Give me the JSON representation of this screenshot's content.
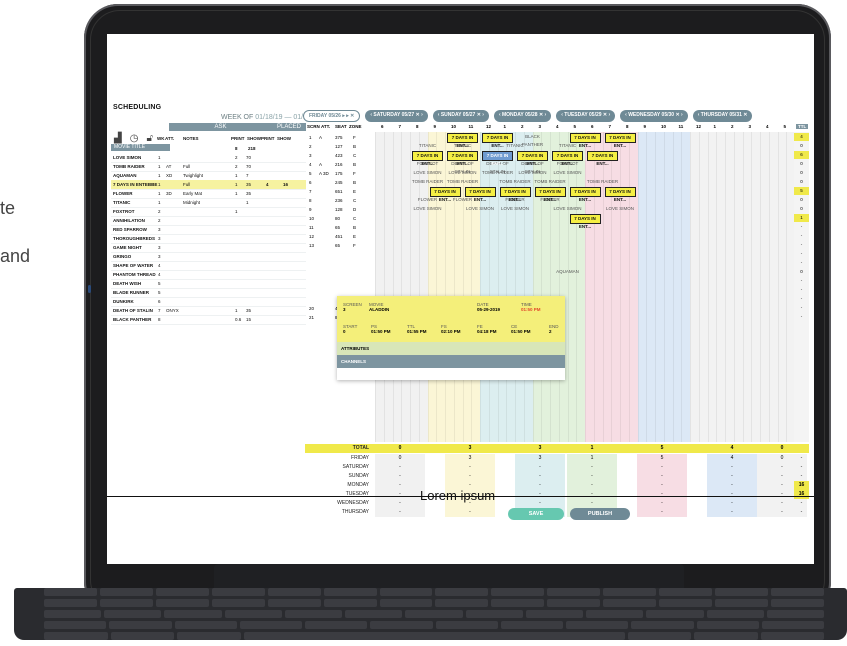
{
  "side_text": [
    "te",
    "and"
  ],
  "app": {
    "title": "SCHEDULING",
    "week_label": "WEEK OF",
    "week_from": "01/18/19",
    "week_sep": "—",
    "week_to": "01/24/19"
  },
  "day_tabs": [
    "FRIDAY 05/26 ▸ ▸ ✕",
    "‹ SATURDAY 05/27 ✕ ›",
    "‹ SUNDAY 05/27 ✕ ›",
    "‹ MONDAY 05/28 ✕ ›",
    "‹ TUESDAY 05/29 ✕ ›",
    "‹ WEDNESDAY 05/30 ✕ ›",
    "‹ THURSDAY 05/31 ✕"
  ],
  "left": {
    "ask": "ASK",
    "placed": "PLACED",
    "movie_title_header": "MOVIE TITLE",
    "columns": [
      "WK",
      "ATT.",
      "NOTES",
      "PRINT",
      "SHOW",
      "PRINT",
      "SHOW"
    ],
    "totals_row": {
      "print": "8",
      "show": "218"
    },
    "movies": [
      {
        "title": "LOVE SIMON",
        "wk": "1",
        "att": "",
        "notes": "",
        "print": "2",
        "show": "70",
        "pprint": "",
        "pshow": "",
        "hl": false
      },
      {
        "title": "TOMB RAIDER",
        "wk": "1",
        "att": "AT",
        "notes": "Full",
        "print": "2",
        "show": "70",
        "pprint": "",
        "pshow": "",
        "hl": false
      },
      {
        "title": "AQUAMAN",
        "wk": "1",
        "att": "XD",
        "notes": "Twighlight",
        "print": "1",
        "show": "7",
        "pprint": "",
        "pshow": "",
        "hl": false
      },
      {
        "title": "7 DAYS IN ENTEBBE",
        "wk": "1",
        "att": "",
        "notes": "Full",
        "print": "1",
        "show": "35",
        "pprint": "4",
        "pshow": "16",
        "hl": true
      },
      {
        "title": "FLOWER",
        "wk": "1",
        "att": "3D",
        "notes": "Early Mat",
        "print": "1",
        "show": "35",
        "pprint": "",
        "pshow": "",
        "hl": false
      },
      {
        "title": "TITANIC",
        "wk": "1",
        "att": "",
        "notes": "Midnight",
        "print": "",
        "show": "1",
        "pprint": "",
        "pshow": "",
        "hl": false
      },
      {
        "title": "FOXTROT",
        "wk": "2",
        "att": "",
        "notes": "",
        "print": "1",
        "show": "",
        "pprint": "",
        "pshow": "",
        "hl": false
      },
      {
        "title": "ANNIHILATION",
        "wk": "2",
        "att": "",
        "notes": "",
        "print": "",
        "show": "",
        "pprint": "",
        "pshow": "",
        "hl": false
      },
      {
        "title": "RED SPARROW",
        "wk": "3",
        "att": "",
        "notes": "",
        "print": "",
        "show": "",
        "pprint": "",
        "pshow": "",
        "hl": false
      },
      {
        "title": "THOROUGHBREDS",
        "wk": "3",
        "att": "",
        "notes": "",
        "print": "",
        "show": "",
        "pprint": "",
        "pshow": "",
        "hl": false
      },
      {
        "title": "GAME NIGHT",
        "wk": "3",
        "att": "",
        "notes": "",
        "print": "",
        "show": "",
        "pprint": "",
        "pshow": "",
        "hl": false
      },
      {
        "title": "GRINGO",
        "wk": "3",
        "att": "",
        "notes": "",
        "print": "",
        "show": "",
        "pprint": "",
        "pshow": "",
        "hl": false
      },
      {
        "title": "SHAPE OF WATER",
        "wk": "4",
        "att": "",
        "notes": "",
        "print": "",
        "show": "",
        "pprint": "",
        "pshow": "",
        "hl": false
      },
      {
        "title": "PHANTOM THREAD",
        "wk": "4",
        "att": "",
        "notes": "",
        "print": "",
        "show": "",
        "pprint": "",
        "pshow": "",
        "hl": false
      },
      {
        "title": "DEATH WISH",
        "wk": "5",
        "att": "",
        "notes": "",
        "print": "",
        "show": "",
        "pprint": "",
        "pshow": "",
        "hl": false
      },
      {
        "title": "BLADE RUNNER",
        "wk": "5",
        "att": "",
        "notes": "",
        "print": "",
        "show": "",
        "pprint": "",
        "pshow": "",
        "hl": false
      },
      {
        "title": "DUNKIRK",
        "wk": "6",
        "att": "",
        "notes": "",
        "print": "",
        "show": "",
        "pprint": "",
        "pshow": "",
        "hl": false
      },
      {
        "title": "DEATH OF STALIN",
        "wk": "7",
        "att": "ONYX",
        "notes": "",
        "print": "1",
        "show": "35",
        "pprint": "",
        "pshow": "",
        "hl": false
      },
      {
        "title": "BLACK PANTHER",
        "wk": "8",
        "att": "",
        "notes": "",
        "print": "0.6",
        "show": "15",
        "pprint": "",
        "pshow": "",
        "hl": false
      }
    ]
  },
  "grid": {
    "headers": [
      "SCRN",
      "ATT.",
      "SEAT",
      "ZONE"
    ],
    "hours": [
      "6",
      "7",
      "8",
      "9",
      "10",
      "11",
      "12",
      "1",
      "2",
      "3",
      "4",
      "5",
      "6",
      "7",
      "8",
      "9",
      "10",
      "11",
      "12",
      "1",
      "2",
      "3",
      "4",
      "5"
    ],
    "ttl_label": "TTL",
    "screens": [
      {
        "scrn": "1",
        "att": "A",
        "seat": "375",
        "zone": "F",
        "ttl": "4"
      },
      {
        "scrn": "2",
        "att": "",
        "seat": "127",
        "zone": "B",
        "ttl": "0"
      },
      {
        "scrn": "3",
        "att": "",
        "seat": "423",
        "zone": "C",
        "ttl": "6"
      },
      {
        "scrn": "4",
        "att": "A",
        "seat": "216",
        "zone": "B",
        "ttl": "0"
      },
      {
        "scrn": "5",
        "att": "A 3D",
        "seat": "175",
        "zone": "F",
        "ttl": "0"
      },
      {
        "scrn": "6",
        "att": "",
        "seat": "245",
        "zone": "B",
        "ttl": "0"
      },
      {
        "scrn": "7",
        "att": "",
        "seat": "651",
        "zone": "E",
        "ttl": "5"
      },
      {
        "scrn": "8",
        "att": "",
        "seat": "236",
        "zone": "C",
        "ttl": "0"
      },
      {
        "scrn": "9",
        "att": "",
        "seat": "128",
        "zone": "D",
        "ttl": "0"
      },
      {
        "scrn": "10",
        "att": "",
        "seat": "80",
        "zone": "C",
        "ttl": "1"
      },
      {
        "scrn": "11",
        "att": "",
        "seat": "65",
        "zone": "B",
        "ttl": "-"
      },
      {
        "scrn": "12",
        "att": "",
        "seat": "451",
        "zone": "E",
        "ttl": "-"
      },
      {
        "scrn": "13",
        "att": "",
        "seat": "65",
        "zone": "F",
        "ttl": "-"
      },
      {
        "scrn": "",
        "att": "",
        "seat": "",
        "zone": "",
        "ttl": "-"
      },
      {
        "scrn": "",
        "att": "",
        "seat": "",
        "zone": "",
        "ttl": "-"
      },
      {
        "scrn": "",
        "att": "",
        "seat": "",
        "zone": "",
        "ttl": "0"
      },
      {
        "scrn": "",
        "att": "",
        "seat": "",
        "zone": "",
        "ttl": "-"
      },
      {
        "scrn": "",
        "att": "",
        "seat": "",
        "zone": "",
        "ttl": "-"
      },
      {
        "scrn": "",
        "att": "",
        "seat": "",
        "zone": "",
        "ttl": "-"
      },
      {
        "scrn": "20",
        "att": "",
        "seat": "451",
        "zone": "A",
        "ttl": "-"
      },
      {
        "scrn": "21",
        "att": "",
        "seat": "87",
        "zone": "B",
        "ttl": "-"
      }
    ],
    "blocks": [
      {
        "row": 0,
        "col": 4,
        "w": 2,
        "text": "7 DAYS IN ENT...",
        "kind": "yellow"
      },
      {
        "row": 0,
        "col": 6,
        "w": 2,
        "text": "7 DAYS IN ENT...",
        "kind": "yellow"
      },
      {
        "row": 0,
        "col": 11,
        "w": 2,
        "text": "7 DAYS IN ENT...",
        "kind": "yellow"
      },
      {
        "row": 0,
        "col": 13,
        "w": 2,
        "text": "7 DAYS IN ENT...",
        "kind": "yellow"
      },
      {
        "row": 2,
        "col": 2,
        "w": 2,
        "text": "7 DAYS IN ENT...",
        "kind": "yellow"
      },
      {
        "row": 2,
        "col": 4,
        "w": 2,
        "text": "7 DAYS IN ENT...",
        "kind": "yellow"
      },
      {
        "row": 2,
        "col": 6,
        "w": 2,
        "text": "7 DAYS IN ENT...",
        "kind": "blue"
      },
      {
        "row": 2,
        "col": 8,
        "w": 2,
        "text": "7 DAYS IN ENT...",
        "kind": "yellow"
      },
      {
        "row": 2,
        "col": 10,
        "w": 2,
        "text": "7 DAYS IN ENT...",
        "kind": "yellow"
      },
      {
        "row": 2,
        "col": 12,
        "w": 2,
        "text": "7 DAYS IN ENT...",
        "kind": "yellow"
      },
      {
        "row": 6,
        "col": 3,
        "w": 2,
        "text": "7 DAYS IN ENT...",
        "kind": "yellow"
      },
      {
        "row": 6,
        "col": 5,
        "w": 2,
        "text": "7 DAYS IN ENT...",
        "kind": "yellow"
      },
      {
        "row": 6,
        "col": 7,
        "w": 2,
        "text": "7 DAYS IN ENT...",
        "kind": "yellow"
      },
      {
        "row": 6,
        "col": 9,
        "w": 2,
        "text": "7 DAYS IN ENT...",
        "kind": "yellow"
      },
      {
        "row": 6,
        "col": 11,
        "w": 2,
        "text": "7 DAYS IN ENT...",
        "kind": "yellow"
      },
      {
        "row": 6,
        "col": 13,
        "w": 2,
        "text": "7 DAYS IN ENT...",
        "kind": "yellow"
      },
      {
        "row": 9,
        "col": 11,
        "w": 2,
        "text": "7 DAYS IN ENT...",
        "kind": "yellow"
      }
    ],
    "labels": [
      {
        "row": 0,
        "col": 8,
        "w": 2,
        "text": "BLACK PANTHER"
      },
      {
        "row": 1,
        "col": 2,
        "w": 2,
        "text": "TITANIC"
      },
      {
        "row": 1,
        "col": 4,
        "w": 2,
        "text": "TITANIC"
      },
      {
        "row": 1,
        "col": 7,
        "w": 2,
        "text": "TITANIC"
      },
      {
        "row": 1,
        "col": 10,
        "w": 2,
        "text": "TITANIC"
      },
      {
        "row": 3,
        "col": 2,
        "w": 2,
        "text": "FOXTROT"
      },
      {
        "row": 3,
        "col": 4,
        "w": 2,
        "text": "DEATH OF STALIN"
      },
      {
        "row": 3,
        "col": 6,
        "w": 2,
        "text": "DEATH OF STALIN"
      },
      {
        "row": 3,
        "col": 8,
        "w": 2,
        "text": "DEATH OF STALIN"
      },
      {
        "row": 3,
        "col": 10,
        "w": 2,
        "text": "FOXTROT"
      },
      {
        "row": 4,
        "col": 2,
        "w": 2,
        "text": "LOVE SIMON"
      },
      {
        "row": 4,
        "col": 4,
        "w": 2,
        "text": "LOVE SIMON"
      },
      {
        "row": 4,
        "col": 6,
        "w": 2,
        "text": "TOMB RAIDER"
      },
      {
        "row": 4,
        "col": 8,
        "w": 2,
        "text": "LOVE SIMON"
      },
      {
        "row": 4,
        "col": 10,
        "w": 2,
        "text": "LOVE SIMON"
      },
      {
        "row": 5,
        "col": 2,
        "w": 2,
        "text": "TOMB RAIDER"
      },
      {
        "row": 5,
        "col": 4,
        "w": 2,
        "text": "TOMB RAIDER"
      },
      {
        "row": 5,
        "col": 7,
        "w": 2,
        "text": "TOMB RAIDER"
      },
      {
        "row": 5,
        "col": 9,
        "w": 2,
        "text": "TOMB RAIDER"
      },
      {
        "row": 5,
        "col": 12,
        "w": 2,
        "text": "TOMB RAIDER"
      },
      {
        "row": 7,
        "col": 2,
        "w": 2,
        "text": "FLOWER"
      },
      {
        "row": 7,
        "col": 4,
        "w": 2,
        "text": "FLOWER"
      },
      {
        "row": 7,
        "col": 7,
        "w": 2,
        "text": "FLOWER"
      },
      {
        "row": 7,
        "col": 9,
        "w": 2,
        "text": "FLOWER"
      },
      {
        "row": 8,
        "col": 2,
        "w": 2,
        "text": "LOVE SIMON"
      },
      {
        "row": 8,
        "col": 5,
        "w": 2,
        "text": "LOVE SIMON"
      },
      {
        "row": 8,
        "col": 7,
        "w": 2,
        "text": "LOVE SIMON"
      },
      {
        "row": 8,
        "col": 10,
        "w": 2,
        "text": "LOVE SIMON"
      },
      {
        "row": 8,
        "col": 13,
        "w": 2,
        "text": "LOVE SIMON"
      },
      {
        "row": 15,
        "col": 10,
        "w": 2,
        "text": "AQUAMAN"
      }
    ]
  },
  "popup": {
    "screen_label": "SCREEN",
    "screen": "3",
    "movie_label": "MOVIE",
    "movie": "ALADDIN",
    "date_label": "DATE",
    "date": "05-29-2019",
    "time_label": "TIME",
    "time": "01:50 PM",
    "start_label": "START",
    "start": "0",
    "ps_label": "PS",
    "ps": "01:50 PM",
    "ttl_label": "TTL",
    "ttl": "01:55 PM",
    "fs_label": "FS",
    "fs": "02:10 PM",
    "fe_label": "FE",
    "fe": "04:18 PM",
    "ce_label": "CE",
    "ce": "01:50 PM",
    "end_label": "END",
    "end": "2",
    "attributes": "ATTRIBUTES",
    "channels": "CHANNELS"
  },
  "totals": {
    "total_label": "TOTAL",
    "total_values": [
      "0",
      "3",
      "3",
      "1",
      "5",
      "4",
      "0"
    ],
    "total_ttl": "",
    "days": [
      {
        "name": "FRIDAY",
        "values": [
          "0",
          "3",
          "3",
          "1",
          "5",
          "4",
          "0"
        ],
        "ttl": "-"
      },
      {
        "name": "SATURDAY",
        "values": [
          "-",
          "-",
          "-",
          "-",
          "-",
          "-",
          "-"
        ],
        "ttl": "-"
      },
      {
        "name": "SUNDAY",
        "values": [
          "-",
          "-",
          "-",
          "-",
          "-",
          "-",
          "-"
        ],
        "ttl": "-"
      },
      {
        "name": "MONDAY",
        "values": [
          "-",
          "-",
          "-",
          "-",
          "-",
          "-",
          "-"
        ],
        "ttl": "16"
      },
      {
        "name": "TUESDAY",
        "values": [
          "-",
          "-",
          "-",
          "-",
          "-",
          "-",
          "-"
        ],
        "ttl": "16"
      },
      {
        "name": "WEDNESDAY",
        "values": [
          "-",
          "-",
          "-",
          "-",
          "-",
          "-",
          "-"
        ],
        "ttl": "-"
      },
      {
        "name": "THURSDAY",
        "values": [
          "-",
          "-",
          "-",
          "-",
          "-",
          "-",
          "-"
        ],
        "ttl": "-"
      }
    ]
  },
  "actions": {
    "save": "SAVE",
    "publish": "PUBLISH"
  },
  "caption": "Lorem ipsum",
  "colors": {
    "header_slate": "#7d95a0",
    "highlight_yellow": "#f0e94a",
    "block_blue": "#6f9bd0",
    "save_green": "#66c8b0",
    "help_red": "#e8462f",
    "popup_yellow": "#f4ef7a",
    "time_red": "#e24a2b"
  },
  "icons": [
    "chart-icon",
    "clock-icon",
    "lock-icon",
    "help-icon"
  ]
}
